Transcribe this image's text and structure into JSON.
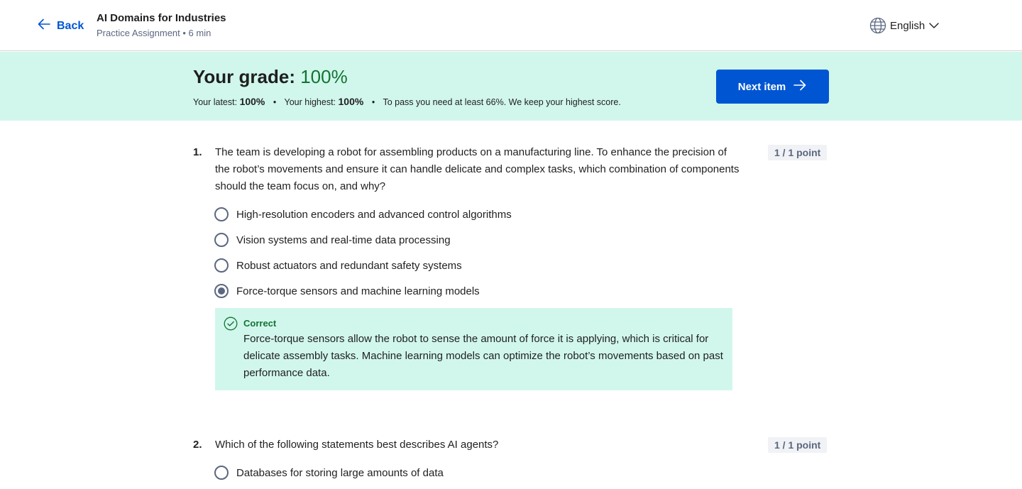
{
  "header": {
    "back_label": "Back",
    "course_title": "AI Domains for Industries",
    "course_subtitle": "Practice Assignment • 6 min",
    "language": "English"
  },
  "grade": {
    "label": "Your grade:",
    "value": "100%",
    "latest_label": "Your latest:",
    "latest_value": "100%",
    "highest_label": "Your highest:",
    "highest_value": "100%",
    "pass_note": "To pass you need at least 66%. We keep your highest score.",
    "next_button": "Next item"
  },
  "questions": [
    {
      "number": "1.",
      "text": "The team is developing a robot for assembling products on a manufacturing line. To enhance the precision of the robot’s movements and ensure it can handle delicate and complex tasks, which combination of components should the team focus on, and why?",
      "points": "1 / 1 point",
      "options": [
        {
          "label": "High-resolution encoders and advanced control algorithms",
          "selected": false
        },
        {
          "label": "Vision systems and real-time data processing",
          "selected": false
        },
        {
          "label": "Robust actuators and redundant safety systems",
          "selected": false
        },
        {
          "label": "Force-torque sensors and machine learning models",
          "selected": true
        }
      ],
      "feedback": {
        "title": "Correct",
        "text": "Force-torque sensors allow the robot to sense the amount of force it is applying, which is critical for delicate assembly tasks. Machine learning models can optimize the robot’s movements based on past performance data."
      }
    },
    {
      "number": "2.",
      "text": "Which of the following statements best describes AI agents?",
      "points": "1 / 1 point",
      "options": [
        {
          "label": "Databases for storing large amounts of data",
          "selected": false
        }
      ]
    }
  ],
  "colors": {
    "accent": "#0056d2",
    "success_bg": "#d1f7ec",
    "success_text": "#137333"
  }
}
